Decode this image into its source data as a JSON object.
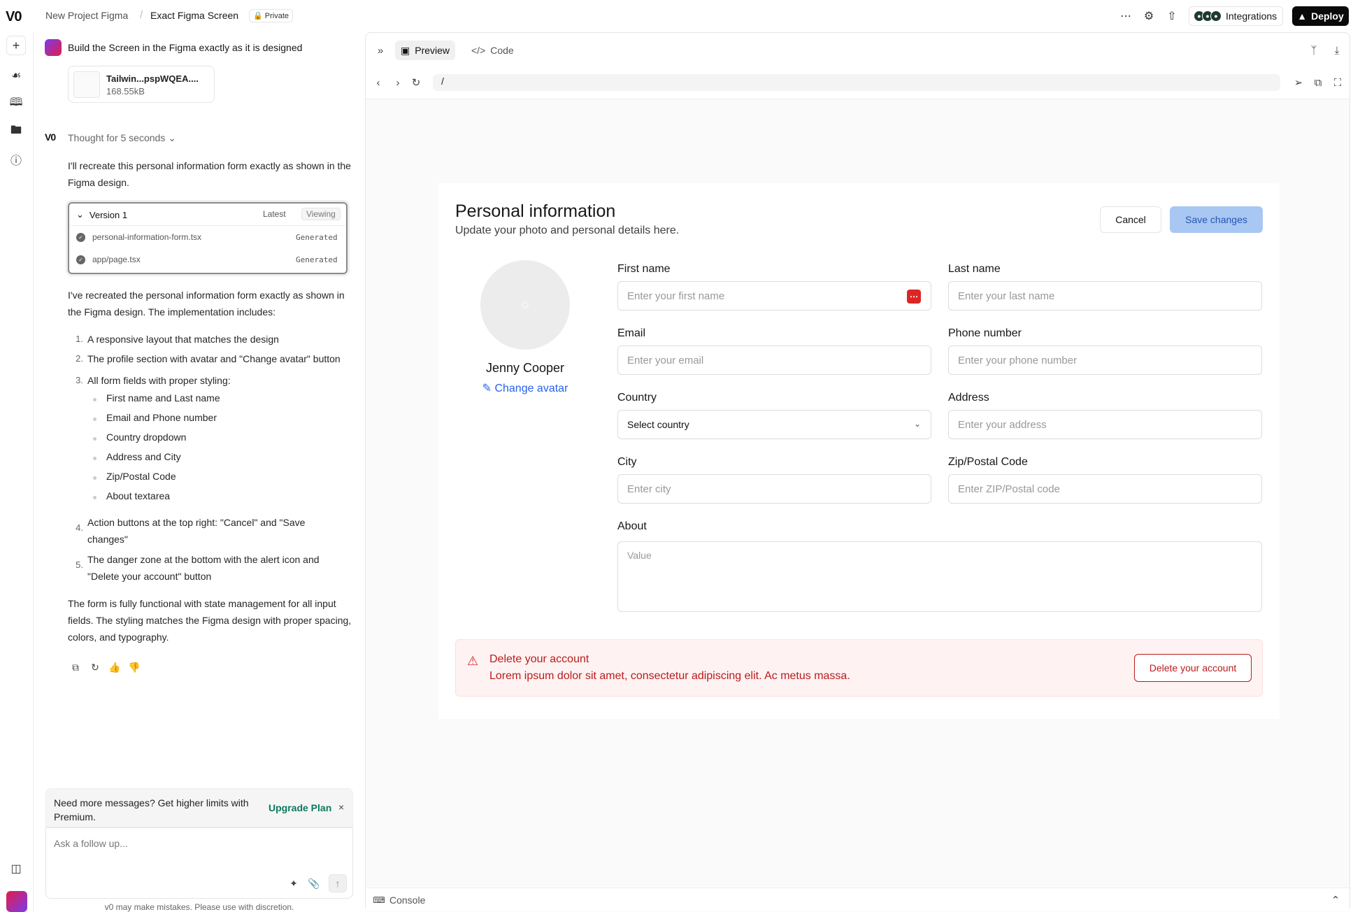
{
  "colors": {
    "accent_blue": "#2563eb",
    "danger_red": "#b91c1c",
    "save_bg": "#a8c7f2",
    "deploy_bg": "#0a0a0a"
  },
  "topbar": {
    "logo": "V0",
    "project": "New Project Figma",
    "separator": "/",
    "chat_title": "Exact Figma Screen",
    "visibility": "Private",
    "integrations_label": "Integrations",
    "deploy_label": "Deploy",
    "icons": [
      "more-icon",
      "gear-icon",
      "share-icon"
    ]
  },
  "chat": {
    "user_message": "Build the Screen in the Figma exactly as it is designed",
    "attachment": {
      "name": "Tailwin...pspWQEA....",
      "size": "168.55kB"
    },
    "thought": "Thought for 5 seconds",
    "intro": "I'll recreate this personal information form exactly as shown in the Figma design.",
    "version": {
      "title": "Version 1",
      "latest": "Latest",
      "viewing": "Viewing",
      "files": [
        {
          "name": "personal-information-form.tsx",
          "status": "Generated"
        },
        {
          "name": "app/page.tsx",
          "status": "Generated"
        }
      ]
    },
    "summary": "I've recreated the personal information form exactly as shown in the Figma design. The implementation includes:",
    "list": [
      "A responsive layout that matches the design",
      "The profile section with avatar and \"Change avatar\" button",
      "All form fields with proper styling:",
      "Action buttons at the top right: \"Cancel\" and \"Save changes\"",
      "The danger zone at the bottom with the alert icon and \"Delete your account\" button"
    ],
    "sublist": [
      "First name and Last name",
      "Email and Phone number",
      "Country dropdown",
      "Address and City",
      "Zip/Postal Code",
      "About textarea"
    ],
    "closing": "The form is fully functional with state management for all input fields. The styling matches the Figma design with proper spacing, colors, and typography.",
    "upgrade": {
      "text": "Need more messages? Get higher limits with Premium.",
      "link": "Upgrade Plan",
      "close": "×"
    },
    "composer_placeholder": "Ask a follow up...",
    "disclaimer": "v0 may make mistakes. Please use with discretion."
  },
  "pane": {
    "tabs": {
      "preview": "Preview",
      "code": "Code"
    },
    "url": "/",
    "console": "Console"
  },
  "form": {
    "title": "Personal information",
    "subtitle": "Update your photo and personal details here.",
    "cancel": "Cancel",
    "save": "Save changes",
    "profile_name": "Jenny Cooper",
    "change_avatar": "Change avatar",
    "fields": {
      "first_name": {
        "label": "First name",
        "placeholder": "Enter your first name"
      },
      "last_name": {
        "label": "Last name",
        "placeholder": "Enter your last name"
      },
      "email": {
        "label": "Email",
        "placeholder": "Enter your email"
      },
      "phone": {
        "label": "Phone number",
        "placeholder": "Enter your phone number"
      },
      "country": {
        "label": "Country",
        "value": "Select country"
      },
      "address": {
        "label": "Address",
        "placeholder": "Enter your address"
      },
      "city": {
        "label": "City",
        "placeholder": "Enter city"
      },
      "zip": {
        "label": "Zip/Postal Code",
        "placeholder": "Enter ZIP/Postal code"
      },
      "about": {
        "label": "About",
        "placeholder": "Value"
      }
    },
    "danger": {
      "title": "Delete your account",
      "text": "Lorem ipsum dolor sit amet, consectetur adipiscing elit. Ac metus massa.",
      "button": "Delete your account"
    }
  }
}
